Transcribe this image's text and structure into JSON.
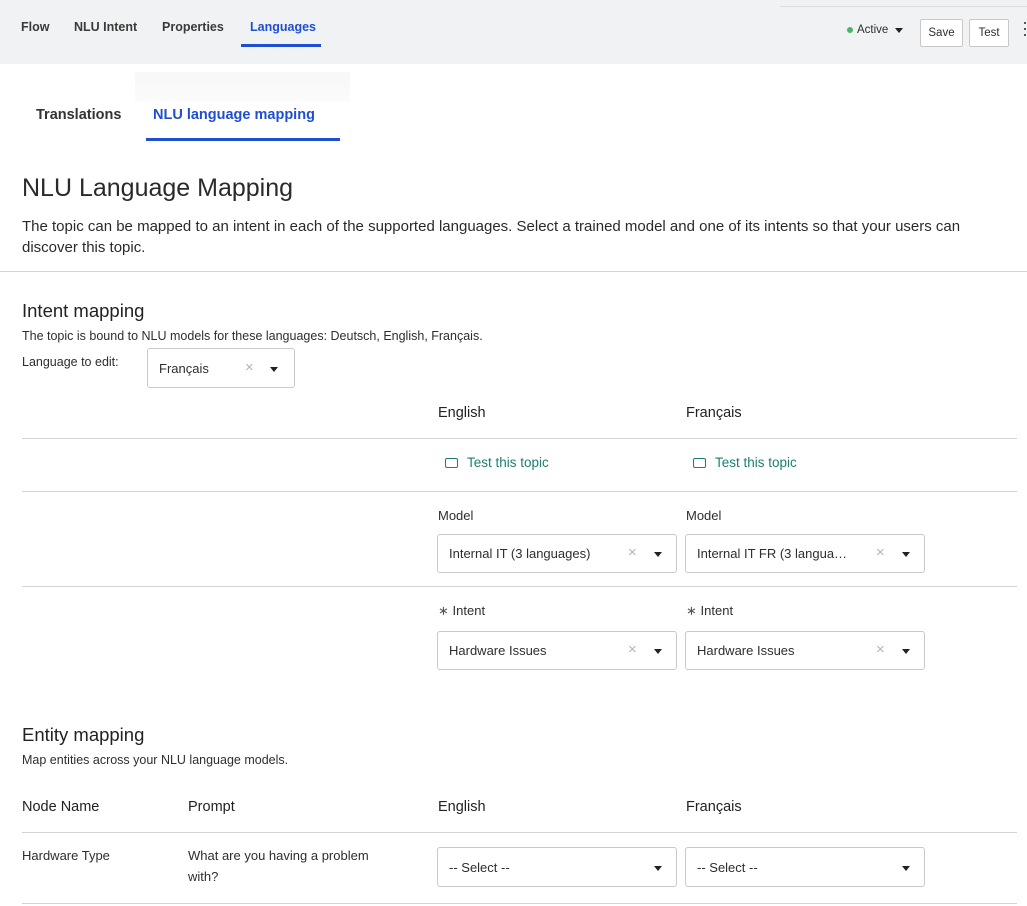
{
  "top_nav": {
    "tabs": [
      {
        "label": "Flow"
      },
      {
        "label": "NLU Intent"
      },
      {
        "label": "Properties"
      },
      {
        "label": "Languages"
      }
    ],
    "status": "Active",
    "save_label": "Save",
    "test_label": "Test"
  },
  "sub_nav": {
    "tabs": [
      {
        "label": "Translations"
      },
      {
        "label": "NLU language mapping"
      }
    ]
  },
  "page": {
    "title": "NLU Language Mapping",
    "description": "The topic can be mapped to an intent in each of the supported languages. Select a trained model and one of its intents so that your users can discover this topic."
  },
  "intent_mapping": {
    "heading": "Intent mapping",
    "bound_text": "The topic is bound to NLU models for these languages: Deutsch, English, Français.",
    "language_label": "Language to edit:",
    "language_value": "Français",
    "columns": [
      "English",
      "Français"
    ],
    "test_link": "Test this topic",
    "model_label": "Model",
    "intent_label": "Intent",
    "required_mark": "∗",
    "models": [
      "Internal IT (3 languages)",
      "Internal IT FR (3 langua…"
    ],
    "intents": [
      "Hardware Issues",
      "Hardware Issues"
    ]
  },
  "entity_mapping": {
    "heading": "Entity mapping",
    "subtitle": "Map entities across your NLU language models.",
    "headers": [
      "Node Name",
      "Prompt",
      "English",
      "Français"
    ],
    "rows": [
      {
        "node": "Hardware Type",
        "prompt_line1": "What are you having a problem",
        "prompt_line2": "with?",
        "english": "-- Select --",
        "french": "-- Select --"
      }
    ]
  },
  "icons": {
    "clear": "×",
    "test": "chat-bubble-icon"
  },
  "colors": {
    "accent": "#1f4fd1",
    "link": "#1d7f74",
    "status_active": "#4db36a"
  }
}
